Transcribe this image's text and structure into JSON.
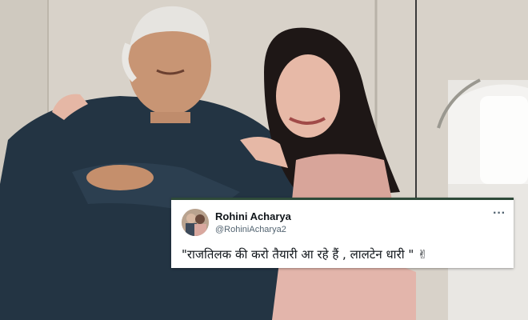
{
  "tweet": {
    "display_name": "Rohini Acharya",
    "handle": "@RohiniAcharya2",
    "more_icon": "···",
    "text": "\"राजतिलक की करो तैयारी आ रहे हैं , लालटेन धारी \"",
    "emoji": "✌"
  },
  "colors": {
    "card_border": "#2e4a39",
    "name": "#0f1419",
    "handle": "#536471"
  }
}
